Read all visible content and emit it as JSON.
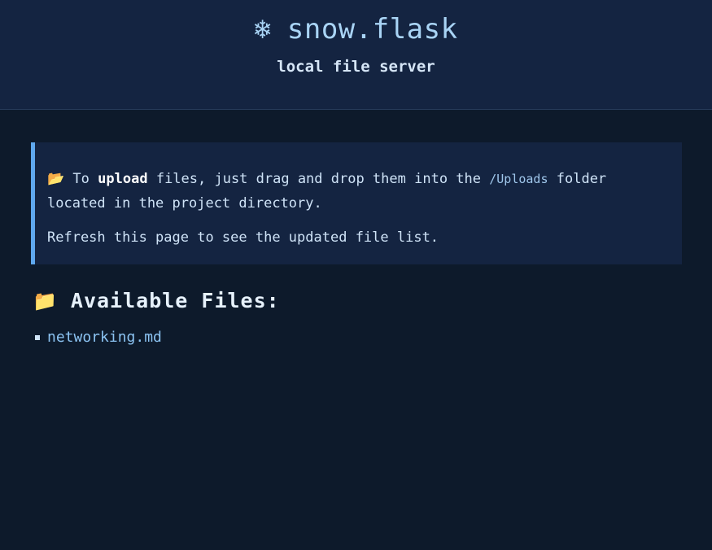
{
  "header": {
    "icon": "snowflake-icon",
    "icon_glyph": "❄",
    "title": "snow.flask",
    "subtitle": "local file server"
  },
  "info": {
    "icon": "open-folder-icon",
    "icon_glyph": "📂",
    "text_before_bold": "To",
    "bold_word": "upload",
    "text_mid": "files, just drag and drop them into the",
    "folder_path": "/Uploads",
    "text_after": "folder located in the project directory.",
    "refresh_text": "Refresh this page to see the updated file list."
  },
  "files": {
    "icon": "folder-icon",
    "icon_glyph": "📁",
    "heading": "Available Files:",
    "items": [
      {
        "name": "networking.md"
      }
    ]
  },
  "colors": {
    "background": "#0d1a2b",
    "panel": "#142441",
    "accent": "#5fa8ee",
    "link": "#8cc4f3"
  }
}
